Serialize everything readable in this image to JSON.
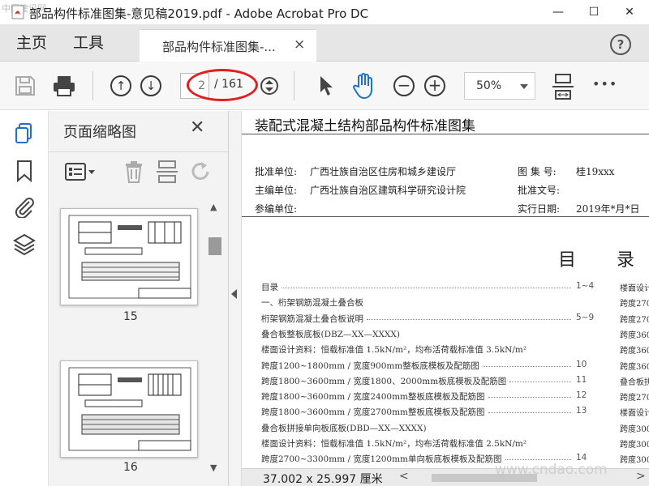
{
  "window": {
    "title": "部品构件标准图集-意见稿2019.pdf - Adobe Acrobat Pro DC",
    "watermark_corner": "中国建设网",
    "minimize": "—",
    "maximize": "☐",
    "close": "✕"
  },
  "tabs": {
    "home": "主页",
    "tools": "工具",
    "document": "部品构件标准图集-...",
    "close": "×",
    "help": "?"
  },
  "toolbar": {
    "page_current": "2",
    "page_total": "/ 161",
    "zoom": "50%",
    "more": "•••",
    "icons": [
      "save-icon",
      "print-icon",
      "prev-page-icon",
      "next-page-icon",
      "page-stepper-icon",
      "select-arrow-icon",
      "hand-tool-icon",
      "zoom-out-icon",
      "zoom-in-icon",
      "zoom-dropdown",
      "fit-page-icon",
      "more-icon"
    ],
    "annotation_color": "#e02020"
  },
  "sidebar": {
    "title": "页面缩略图",
    "close": "✕",
    "icons": [
      "page-thumbnails-icon",
      "bookmarks-icon",
      "attachments-icon",
      "layers-icon"
    ],
    "thumbnails": [
      {
        "number": "15"
      },
      {
        "number": "16"
      }
    ]
  },
  "document": {
    "title": "装配式混凝土结构部品构件标准图集",
    "meta_left": [
      {
        "label": "批准单位:",
        "value": "广西壮族自治区住房和城乡建设厅"
      },
      {
        "label": "主编单位:",
        "value": "广西壮族自治区建筑科学研究设计院"
      },
      {
        "label": "参编单位:",
        "value": ""
      }
    ],
    "meta_right": [
      {
        "label": "图 集 号:",
        "value": "桂19xxx"
      },
      {
        "label": "批准文号:",
        "value": ""
      },
      {
        "label": "实行日期:",
        "value": "2019年*月*日"
      }
    ],
    "toc_title_1": "目",
    "toc_title_2": "录",
    "toc": [
      {
        "text": "目录",
        "page": "1~4"
      },
      {
        "text": "一、桁架钢筋混凝土叠合板",
        "page": ""
      },
      {
        "text": "桁架钢筋混凝土叠合板说明",
        "page": "5~9"
      },
      {
        "text": "叠合板整板底板(DBZ—XX—XXXX)",
        "page": ""
      },
      {
        "text": "楼面设计资料：恒载标准值 1.5kN/m²，均布活荷载标准值 3.5kN/m²",
        "page": ""
      },
      {
        "text": "跨度1200~1800mm / 宽度900mm整板底模板及配筋图",
        "page": "10"
      },
      {
        "text": "跨度1800~3600mm / 宽度1800、2000mm板底模板及配筋图",
        "page": "11"
      },
      {
        "text": "跨度1800~3600mm / 宽度2400mm整板底模板及配筋图",
        "page": "12"
      },
      {
        "text": "跨度1800~3600mm / 宽度2700mm整板底模板及配筋图",
        "page": "13"
      },
      {
        "text": "叠合板拼接单向板底板(DBD—XX—XXXX)",
        "page": ""
      },
      {
        "text": "楼面设计资料：恒载标准值 1.5kN/m²，均布活荷载标准值 2.5kN/m²",
        "page": ""
      },
      {
        "text": "跨度2700~3300mm / 宽度1200mm单向板底板模板及配筋图",
        "page": "14"
      }
    ],
    "toc_right": [
      "楼面设计",
      "跨度270",
      "跨度270",
      "跨度360",
      "跨度360",
      "跨度360",
      "叠合板拼",
      "跨度270",
      "楼面设计",
      "跨度300",
      "跨度300",
      "跨度300"
    ]
  },
  "status": {
    "dimensions": "37.002 x 25.997 厘米",
    "left_arrow": "<",
    "right_arrow": ">",
    "watermark": "www.cndao.com"
  }
}
